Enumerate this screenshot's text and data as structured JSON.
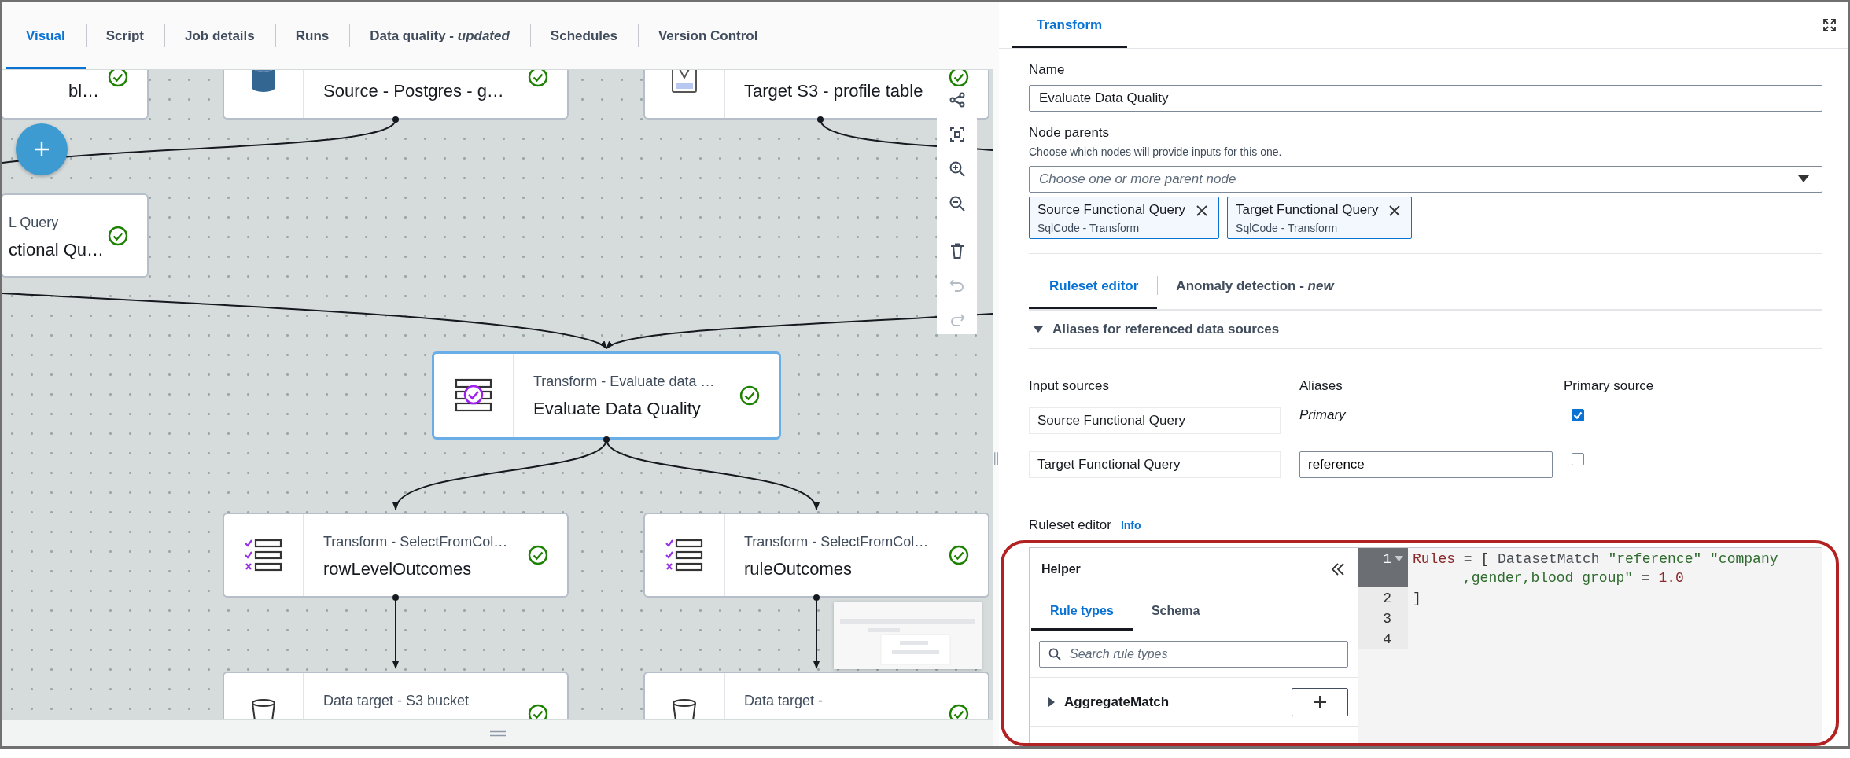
{
  "tabs": [
    {
      "label": "Visual",
      "selected": true
    },
    {
      "label": "Script",
      "selected": false
    },
    {
      "label": "Job details",
      "selected": false
    },
    {
      "label": "Runs",
      "selected": false
    },
    {
      "label": "Data quality - *updated*",
      "selected": false
    },
    {
      "label": "Schedules",
      "selected": false
    },
    {
      "label": "Version Control",
      "selected": false
    }
  ],
  "canvas": {
    "nodes": [
      {
        "kind": "cut",
        "title": "bl…",
        "succeeded": true,
        "selected": false
      },
      {
        "kind": "postgres",
        "title": "Source - Postgres - g…",
        "succeeded": true,
        "selected": false
      },
      {
        "kind": "s3",
        "title": "Target S3 - profile table",
        "succeeded": true,
        "selected": false
      },
      {
        "kind": "cut",
        "subtitle": "L Query",
        "title": "ctional Qu…",
        "succeeded": true,
        "selected": false
      },
      {
        "kind": "evaluate",
        "subtitle": "Transform - Evaluate data …",
        "title": "Evaluate Data Quality",
        "succeeded": true,
        "selected": true
      },
      {
        "kind": "select",
        "subtitle": "Transform - SelectFromCol…",
        "title": "rowLevelOutcomes",
        "succeeded": true,
        "selected": false
      },
      {
        "kind": "select",
        "subtitle": "Transform - SelectFromCol…",
        "title": "ruleOutcomes",
        "succeeded": true,
        "selected": false
      },
      {
        "kind": "bucket",
        "subtitle": "Data target - S3 bucket",
        "succeeded": true,
        "selected": false
      },
      {
        "kind": "bucket",
        "subtitle": "Data target -",
        "succeeded": true,
        "selected": false
      }
    ],
    "toolbar": [
      {
        "kind": "layout",
        "disabled": false
      },
      {
        "kind": "fit",
        "disabled": false
      },
      {
        "kind": "zoom-in",
        "disabled": false
      },
      {
        "kind": "zoom-out",
        "disabled": false
      },
      {
        "kind": "delete",
        "disabled": false
      },
      {
        "kind": "undo",
        "disabled": true
      },
      {
        "kind": "redo",
        "disabled": true
      }
    ]
  },
  "panel": {
    "tab": "Transform",
    "name_label": "Name",
    "name_value": "Evaluate Data Quality",
    "parents_label": "Node parents",
    "parents_hint": "Choose which nodes will provide inputs for this one.",
    "parents_placeholder": "Choose one or more parent node",
    "parents": [
      {
        "name": "Source Functional Query",
        "type": "SqlCode - Transform"
      },
      {
        "name": "Target Functional Query",
        "type": "SqlCode - Transform"
      }
    ],
    "subtabs": [
      {
        "label": "Ruleset editor",
        "selected": true
      },
      {
        "label": "Anomaly detection - *new*",
        "selected": false
      }
    ],
    "aliases": {
      "title": "Aliases for referenced data sources",
      "expanded": true,
      "columns": [
        "Input sources",
        "Aliases",
        "Primary source"
      ],
      "rows": [
        {
          "source": "Source Functional Query",
          "alias": "Primary",
          "kind": "label",
          "primary": true
        },
        {
          "source": "Target Functional Query",
          "alias": "reference",
          "kind": "input",
          "primary": false
        }
      ]
    },
    "ruleset": {
      "label": "Ruleset editor",
      "info": "Info",
      "helper": {
        "title": "Helper",
        "tabs": [
          {
            "label": "Rule types",
            "selected": true
          },
          {
            "label": "Schema",
            "selected": false
          }
        ],
        "search_placeholder": "Search rule types",
        "items": [
          {
            "name": "AggregateMatch",
            "expanded": false
          }
        ]
      },
      "code": [
        {
          "number": "1",
          "active": true,
          "foldable": true,
          "rows": [
            {
              "tokens": [
                {
                  "text": "Rules",
                  "color": "#8a2a2a"
                },
                {
                  "text": " = ",
                  "color": "#666666"
                },
                {
                  "text": "[ ",
                  "color": "#333333"
                },
                {
                  "text": "DatasetMatch ",
                  "color": "#4a4f55"
                },
                {
                  "text": "\"reference\" \"company",
                  "color": "#2f6b2f"
                }
              ]
            },
            {
              "tokens": [
                {
                  "text": ",gender,blood_group\"",
                  "color": "#2f6b2f"
                },
                {
                  "text": " = ",
                  "color": "#666666"
                },
                {
                  "text": "1.0",
                  "color": "#8a2a2a"
                }
              ]
            }
          ]
        },
        {
          "number": "2",
          "active": false,
          "foldable": false,
          "rows": [
            {
              "tokens": [
                {
                  "text": "]",
                  "color": "#333333"
                }
              ]
            }
          ]
        },
        {
          "number": "3",
          "active": false,
          "foldable": false
        },
        {
          "number": "4",
          "active": false,
          "foldable": false
        }
      ]
    }
  }
}
